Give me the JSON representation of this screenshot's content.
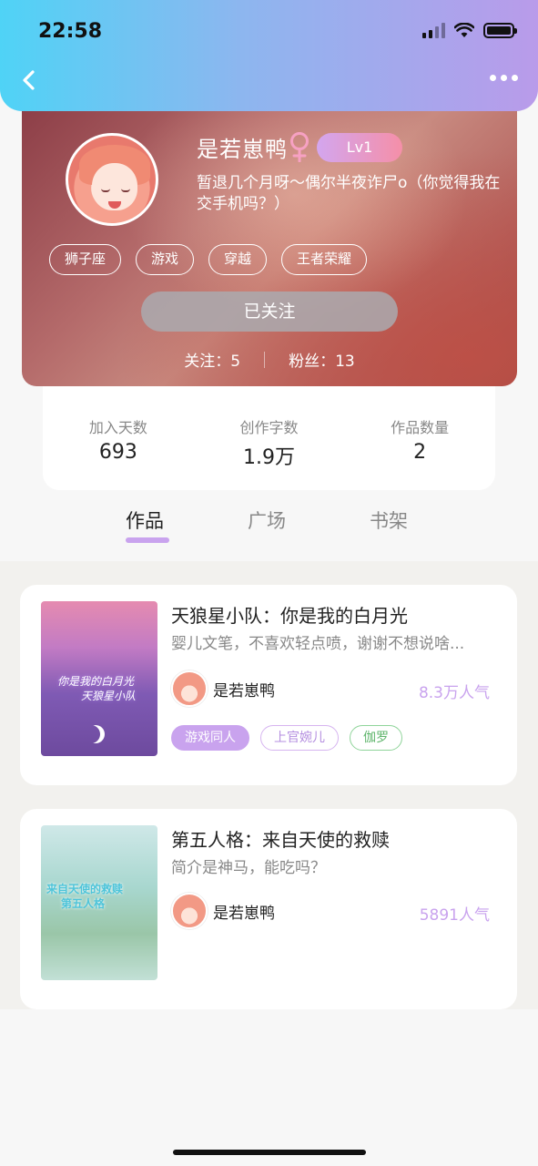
{
  "status_bar": {
    "time": "22:58"
  },
  "header": {
    "back_icon": "chevron-left-icon",
    "more_icon": "more-dots-icon"
  },
  "profile": {
    "username": "是若崽鸭",
    "gender": "female",
    "level": "Lv1",
    "bio_line1": "暂退几个月呀～偶尔半夜诈尸o（你觉得我在",
    "bio_line2": "交手机吗？）",
    "tags": [
      "狮子座",
      "游戏",
      "穿越",
      "王者荣耀"
    ],
    "follow_label": "已关注",
    "following_label": "关注：5",
    "fans_label": "粉丝：13"
  },
  "stats": [
    {
      "label": "加入天数",
      "value": "693"
    },
    {
      "label": "创作字数",
      "value": "1.9万"
    },
    {
      "label": "作品数量",
      "value": "2"
    }
  ],
  "tabs": [
    {
      "label": "作品",
      "active": true
    },
    {
      "label": "广场",
      "active": false
    },
    {
      "label": "书架",
      "active": false
    }
  ],
  "works": [
    {
      "title": "天狼星小队：你是我的白月光",
      "desc": "婴儿文笔，不喜欢轻点喷，谢谢不想说啥...",
      "author": "是若崽鸭",
      "popularity": "8.3万人气",
      "cover_text_1": "你是我的白月光",
      "cover_text_2": "天狼星小队",
      "chips": [
        "游戏同人",
        "上官婉儿",
        "伽罗"
      ]
    },
    {
      "title": "第五人格：来自天使的救赎",
      "desc": "简介是神马，能吃吗？",
      "author": "是若崽鸭",
      "popularity": "5891人气",
      "cover_text_1": "来自天使的救赎",
      "cover_text_2": "第五人格",
      "chips": []
    }
  ],
  "colors": {
    "accent": "#c9a3ee",
    "header_start": "#4fd3f6",
    "header_end": "#b99bea"
  }
}
